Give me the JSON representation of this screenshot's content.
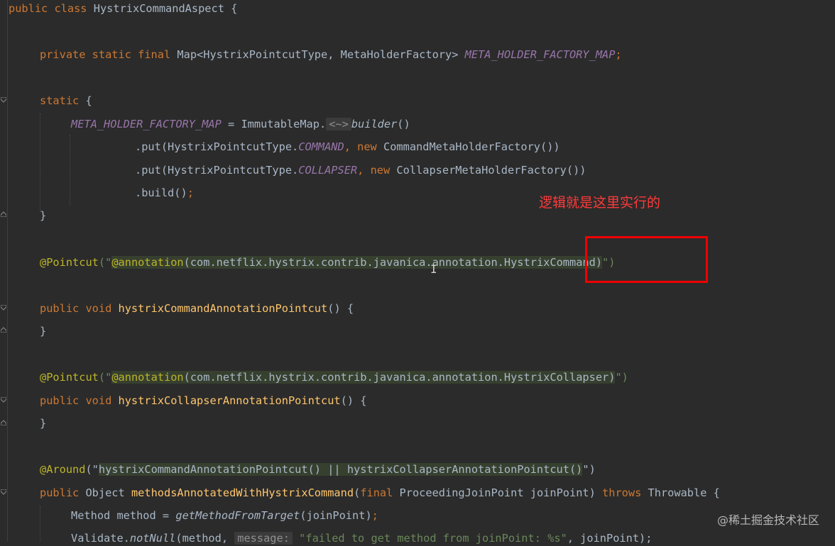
{
  "annotation": {
    "note": "逻辑就是这里实行的",
    "watermark": "@稀土掘金技术社区"
  },
  "code": {
    "l1": {
      "kw": "public class ",
      "name": "HystrixCommandAspect {"
    },
    "l2": {
      "mod": "private static final ",
      "type": "Map<HystrixPointcutType, MetaHolderFactory> ",
      "field": "META_HOLDER_FACTORY_MAP",
      "end": ";"
    },
    "l3": {
      "kw": "static",
      "rest": " {"
    },
    "l4": {
      "field": "META_HOLDER_FACTORY_MAP",
      "mid": " = ImmutableMap.",
      "diamond": "<~>",
      "method": "builder",
      "end": "()"
    },
    "l5": {
      "a": ".put(HystrixPointcutType.",
      "const": "COMMAND",
      "comma": ", ",
      "kw": "new ",
      "b": "CommandMetaHolderFactory())"
    },
    "l6": {
      "a": ".put(HystrixPointcutType.",
      "const": "COLLAPSER",
      "comma": ", ",
      "kw": "new ",
      "b": "CollapserMetaHolderFactory())"
    },
    "l7": {
      "a": ".build()",
      "end": ";"
    },
    "l8": {
      "text": "}"
    },
    "l9": {
      "ann": "@Pointcut",
      "open": "(\"",
      "inj_ann": "@annotation",
      "inj_rest": "(com.netflix.hystrix.contrib.javanica.annotation.HystrixCommand)",
      "close": "\")"
    },
    "l10": {
      "kw": "public void ",
      "fn": "hystrixCommandAnnotationPointcut",
      "rest": "() {"
    },
    "l11": {
      "text": "}"
    },
    "l12": {
      "ann": "@Pointcut",
      "open": "(\"",
      "inj_ann": "@annotation",
      "inj_rest": "(com.netflix.hystrix.contrib.javanica.annotation.HystrixCollapser)",
      "close": "\")"
    },
    "l13": {
      "kw": "public void ",
      "fn": "hystrixCollapserAnnotationPointcut",
      "rest": "() {"
    },
    "l14": {
      "text": "}"
    },
    "l15": {
      "ann": "@Around",
      "open": "(\"",
      "inj": "hystrixCommandAnnotationPointcut() || hystrixCollapserAnnotationPointcut()",
      "close": "\")"
    },
    "l16": {
      "kw": "public ",
      "type": "Object ",
      "fn": "methodsAnnotatedWithHystrixCommand",
      "p1": "(",
      "kw2": "final ",
      "param": "ProceedingJoinPoint joinPoint) ",
      "kw3": "throws ",
      "exc": "Throwable {"
    },
    "l17": {
      "a": "Method method = ",
      "method": "getMethodFromTarget",
      "b": "(joinPoint)",
      "end": ";"
    },
    "l18": {
      "a": "Validate.",
      "method": "notNull",
      "b": "(method, ",
      "hint": "message:",
      "str": " \"failed to get method from joinPoint: %s\"",
      "c": ", joinPoint);"
    }
  }
}
